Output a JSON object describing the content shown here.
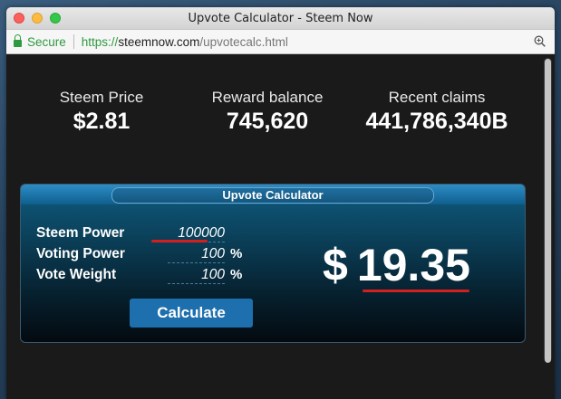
{
  "window": {
    "title": "Upvote Calculator - Steem Now"
  },
  "urlbar": {
    "secure_label": "Secure",
    "url_scheme": "https://",
    "url_domain": "steemnow.com",
    "url_path": "/upvotecalc.html"
  },
  "stats": [
    {
      "label": "Steem Price",
      "value": "$2.81"
    },
    {
      "label": "Reward balance",
      "value": "745,620"
    },
    {
      "label": "Recent claims",
      "value": "441,786,340B"
    }
  ],
  "calculator": {
    "title": "Upvote Calculator",
    "fields": [
      {
        "label": "Steem Power",
        "value": "100000",
        "unit": ""
      },
      {
        "label": "Voting Power",
        "value": "100",
        "unit": "%"
      },
      {
        "label": "Vote Weight",
        "value": "100",
        "unit": "%"
      }
    ],
    "button_label": "Calculate",
    "result_currency": "$",
    "result_value": "19.35"
  },
  "colors": {
    "accent": "#1d6fad",
    "highlight": "#d21f1f",
    "secure": "#2e9a3f"
  }
}
